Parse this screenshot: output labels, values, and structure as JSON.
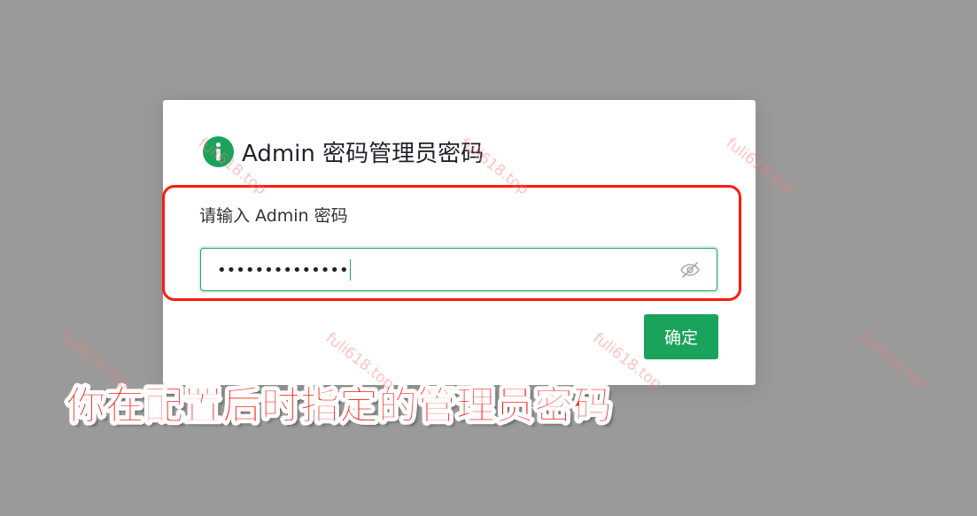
{
  "dialog": {
    "title": "Admin 密码管理员密码",
    "field_label": "请输入 Admin 密码",
    "password_masked": "••••••••••••••",
    "confirm_label": "确定",
    "icon": "info-icon",
    "accent_color": "#1aa35a"
  },
  "annotation": {
    "caption": "你在配置后时指定的管理员密码",
    "highlight_color": "#ff1a10"
  },
  "watermarks": [
    "fuli618.top",
    "fuli618.top",
    "fuli618.top",
    "fuli618.top",
    "fuli618.top",
    "fuli618.top"
  ]
}
